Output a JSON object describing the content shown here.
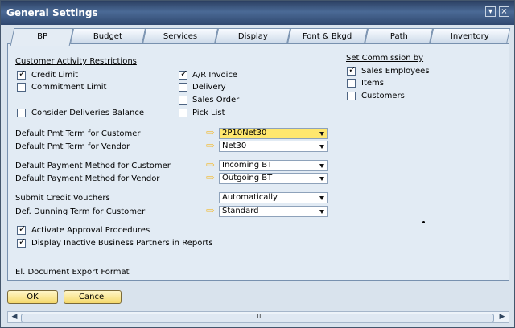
{
  "window": {
    "title": "General Settings",
    "menu_icon": "▾",
    "close_icon": "×"
  },
  "tabs": [
    "BP",
    "Budget",
    "Services",
    "Display",
    "Font & Bkgd",
    "Path",
    "Inventory"
  ],
  "restrictions": {
    "title": "Customer Activity Restrictions",
    "credit_limit": "Credit Limit",
    "commitment_limit": "Commitment Limit",
    "consider_deliveries": "Consider Deliveries Balance",
    "ar_invoice": "A/R Invoice",
    "delivery": "Delivery",
    "sales_order": "Sales Order",
    "pick_list": "Pick List",
    "checked": {
      "credit_limit": true,
      "ar_invoice": true,
      "commitment_limit": false,
      "consider_deliveries": false,
      "delivery": false,
      "sales_order": false,
      "pick_list": false
    }
  },
  "commission": {
    "title": "Set Commission by",
    "sales_employees": "Sales Employees",
    "items": "Items",
    "customers": "Customers",
    "checked": {
      "sales_employees": true,
      "items": false,
      "customers": false
    }
  },
  "fields": {
    "pmt_customer": {
      "label": "Default Pmt Term for Customer",
      "value": "2P10Net30"
    },
    "pmt_vendor": {
      "label": "Default Pmt Term for Vendor",
      "value": "Net30"
    },
    "method_customer": {
      "label": "Default Payment Method for Customer",
      "value": "Incoming BT"
    },
    "method_vendor": {
      "label": "Default Payment Method for Vendor",
      "value": "Outgoing BT"
    },
    "credit_vouchers": {
      "label": "Submit Credit Vouchers",
      "value": "Automatically"
    },
    "dunning_term": {
      "label": "Def. Dunning Term for Customer",
      "value": "Standard"
    }
  },
  "options": {
    "approval": "Activate Approval Procedures",
    "inactive_partners": "Display Inactive Business Partners in Reports",
    "export_format": "El. Document Export Format",
    "checked": {
      "approval": true,
      "inactive_partners": true
    }
  },
  "buttons": {
    "ok": "OK",
    "cancel": "Cancel"
  },
  "scroll": {
    "left": "◀",
    "grip": "⁞⁞",
    "right": "▶"
  },
  "colors": {
    "titlebar": "#30486f",
    "highlight": "#ffe76e",
    "panel": "#e2ebf4"
  }
}
